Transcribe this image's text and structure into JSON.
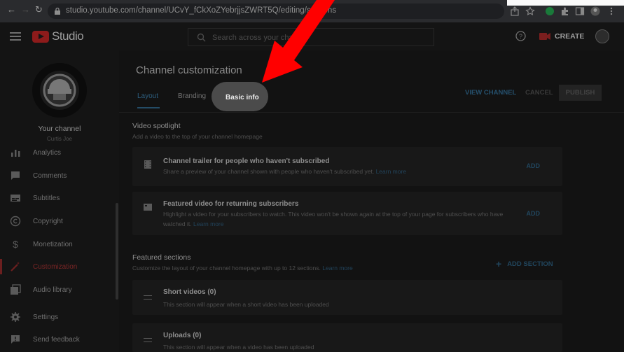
{
  "browser": {
    "url": "studio.youtube.com/channel/UCvY_fCkXoZYebrjjsZWRT5Q/editing/sections"
  },
  "topbar": {
    "brand": "Studio",
    "search_placeholder": "Search across your channel",
    "create_label": "CREATE"
  },
  "sidebar": {
    "channel_title": "Your channel",
    "channel_subtitle": "Curtis Joe",
    "items": [
      {
        "label": "Analytics"
      },
      {
        "label": "Comments"
      },
      {
        "label": "Subtitles"
      },
      {
        "label": "Copyright"
      },
      {
        "label": "Monetization"
      },
      {
        "label": "Customization"
      },
      {
        "label": "Audio library"
      },
      {
        "label": "Settings"
      },
      {
        "label": "Send feedback"
      }
    ]
  },
  "main": {
    "title": "Channel customization",
    "tabs": [
      {
        "label": "Layout"
      },
      {
        "label": "Branding"
      },
      {
        "label": "Basic info"
      }
    ],
    "actions": {
      "view_channel": "VIEW CHANNEL",
      "cancel": "CANCEL",
      "publish": "PUBLISH"
    },
    "video_spotlight": {
      "title": "Video spotlight",
      "desc": "Add a video to the top of your channel homepage",
      "cards": [
        {
          "title": "Channel trailer for people who haven't subscribed",
          "desc": "Share a preview of your channel shown with people who haven't subscribed yet.",
          "link": "Learn more",
          "action": "ADD"
        },
        {
          "title": "Featured video for returning subscribers",
          "desc": "Highlight a video for your subscribers to watch. This video won't be shown again at the top of your page for subscribers who have watched it.",
          "link": "Learn more",
          "action": "ADD"
        }
      ]
    },
    "featured_sections": {
      "title": "Featured sections",
      "desc": "Customize the layout of your channel homepage with up to 12 sections.",
      "link": "Learn more",
      "add_label": "ADD SECTION",
      "sections": [
        {
          "title": "Short videos (0)",
          "desc": "This section will appear when a short video has been uploaded"
        },
        {
          "title": "Uploads (0)",
          "desc": "This section will appear when a video has been uploaded"
        }
      ]
    }
  },
  "colors": {
    "annotation_arrow": "#ff0000",
    "accent_blue": "#3ea6ff",
    "youtube_red": "#ff0000"
  }
}
